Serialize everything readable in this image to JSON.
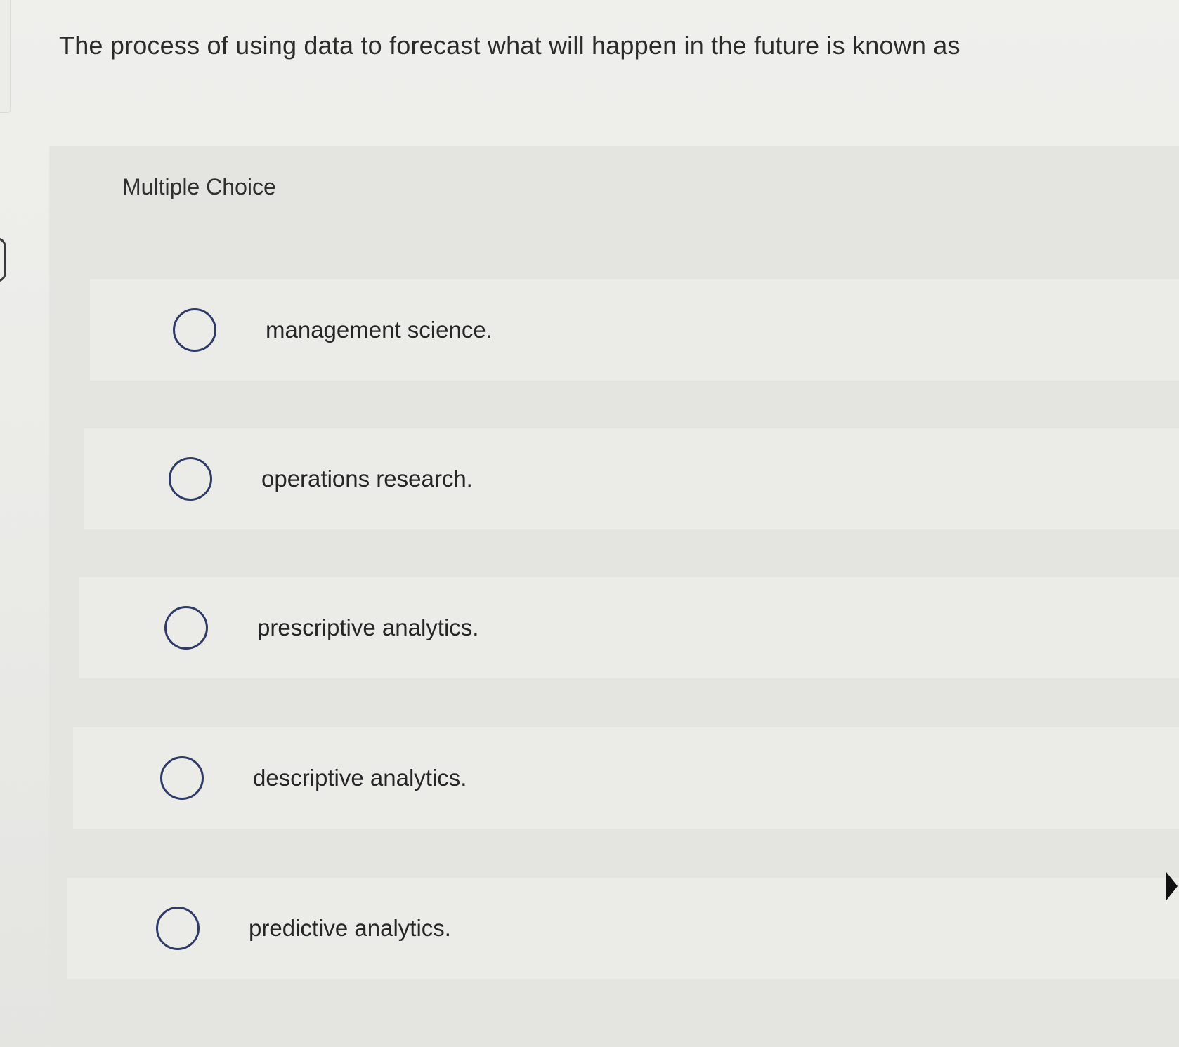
{
  "question": {
    "text": "The process of using data to forecast what will happen in the future is known as"
  },
  "choice_panel": {
    "label": "Multiple Choice",
    "options": [
      {
        "label": "management science.",
        "selected": false
      },
      {
        "label": "operations research.",
        "selected": false
      },
      {
        "label": "prescriptive analytics.",
        "selected": false
      },
      {
        "label": "descriptive analytics.",
        "selected": false
      },
      {
        "label": "predictive analytics.",
        "selected": false
      }
    ]
  },
  "colors": {
    "page_background": "#ebebe8",
    "panel_background": "#e4e4e1",
    "radio_border": "#2f3b66",
    "text": "#2d2d2d"
  },
  "icons": {
    "radio": "radio-unselected-icon",
    "cursor": "mouse-cursor-icon"
  }
}
